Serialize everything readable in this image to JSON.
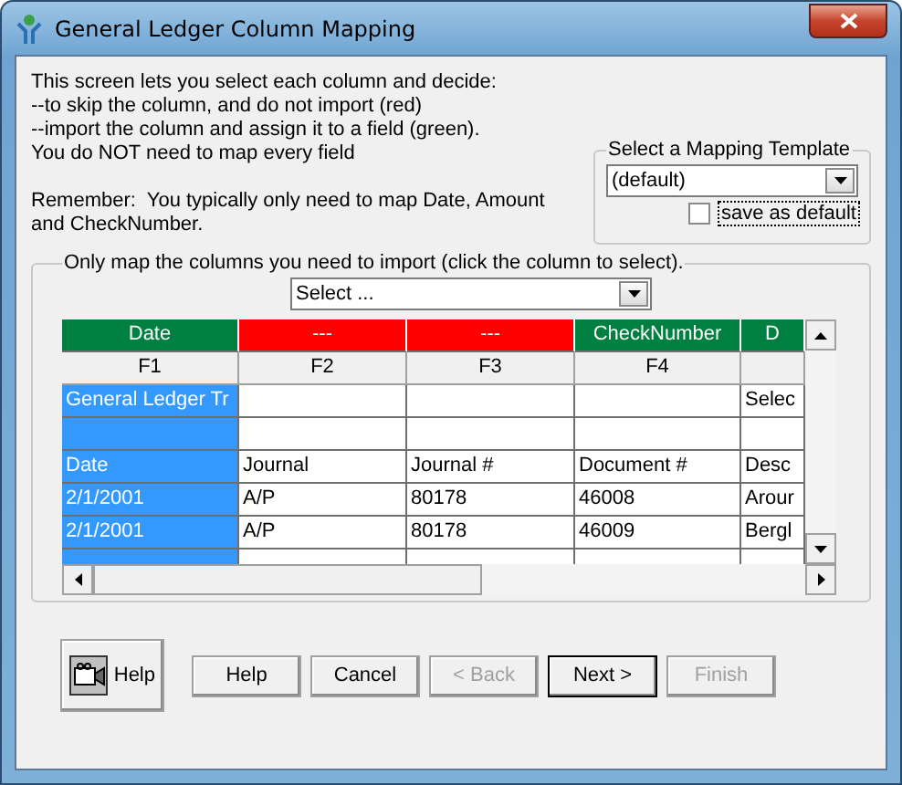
{
  "window": {
    "title": "General Ledger Column Mapping"
  },
  "intro": [
    "This screen lets you select each column and decide:",
    "--to skip the column, and do not import (red)",
    "--import the column and assign it to a field (green).",
    "You do NOT need to map every field"
  ],
  "reminder": "Remember:  You typically only need to map Date, Amount and CheckNumber.",
  "template": {
    "legend": "Select a Mapping Template",
    "value": "(default)",
    "save_default": {
      "label": "save as default",
      "checked": false
    }
  },
  "mapping": {
    "legend": "Only map the columns you need to import (click the column to select).",
    "field_select": {
      "value": "Select ..."
    },
    "columns": [
      {
        "mapping": "Date",
        "kind": "import",
        "header": "F1",
        "selected": true
      },
      {
        "mapping": "---",
        "kind": "skip",
        "header": "F2",
        "selected": false
      },
      {
        "mapping": "---",
        "kind": "skip",
        "header": "F3",
        "selected": false
      },
      {
        "mapping": "CheckNumber",
        "kind": "import",
        "header": "F4",
        "selected": false
      },
      {
        "mapping": "D",
        "kind": "import",
        "selected": false
      }
    ],
    "rows": [
      [
        "General Ledger Tr",
        "",
        "",
        "",
        "Selec"
      ],
      [
        "",
        "",
        "",
        "",
        ""
      ],
      [
        "Date",
        "Journal",
        "Journal #",
        "Document #",
        "Desc"
      ],
      [
        "2/1/2001",
        "A/P",
        "80178",
        "46008",
        "Arour"
      ],
      [
        "2/1/2001",
        "A/P",
        "80178",
        "46009",
        "Bergl"
      ]
    ]
  },
  "buttons": [
    {
      "label": "Help",
      "kind": "icon",
      "disabled": false
    },
    {
      "label": "Help",
      "kind": "text",
      "disabled": false
    },
    {
      "label": "Cancel",
      "kind": "text",
      "disabled": false
    },
    {
      "label": "< Back",
      "kind": "text",
      "disabled": true
    },
    {
      "label": "Next >",
      "kind": "default",
      "disabled": false
    },
    {
      "label": "Finish",
      "kind": "text",
      "disabled": true
    }
  ]
}
